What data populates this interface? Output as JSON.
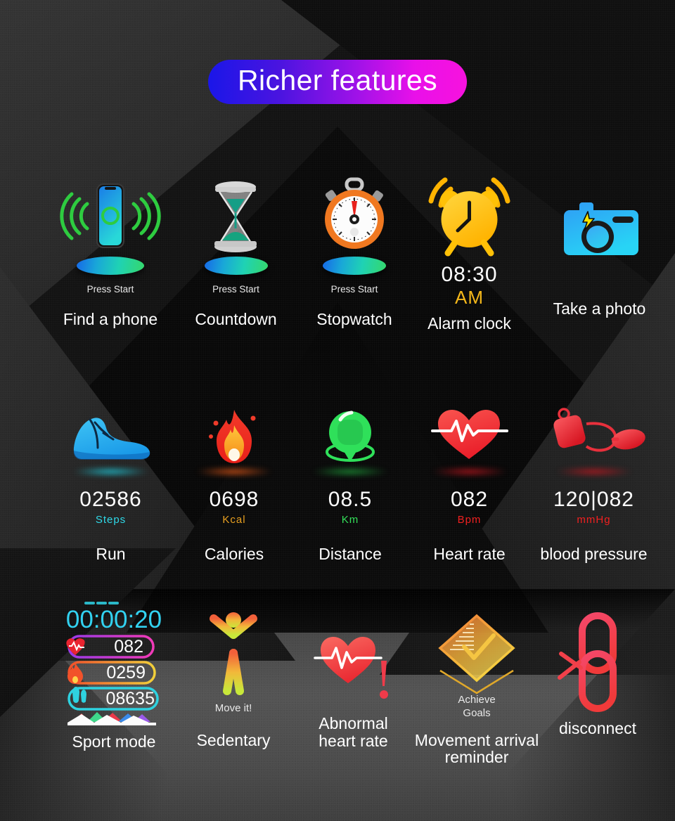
{
  "header": {
    "title": "Richer features"
  },
  "rows": [
    {
      "id": "row-utilities",
      "items": [
        {
          "key": "find-a-phone",
          "icon": "phone-ringing-icon",
          "sub": "Press Start",
          "caption": "Find a phone"
        },
        {
          "key": "countdown",
          "icon": "hourglass-icon",
          "sub": "Press Start",
          "caption": "Countdown"
        },
        {
          "key": "stopwatch",
          "icon": "stopwatch-icon",
          "sub": "Press Start",
          "caption": "Stopwatch"
        },
        {
          "key": "alarm-clock",
          "icon": "alarm-clock-icon",
          "value": "08:30",
          "unit": "AM",
          "caption": "Alarm clock"
        },
        {
          "key": "take-a-photo",
          "icon": "camera-icon",
          "caption": "Take a photo"
        }
      ]
    },
    {
      "id": "row-metrics",
      "items": [
        {
          "key": "run",
          "icon": "running-shoe-icon",
          "value": "02586",
          "unit": "Steps",
          "caption": "Run"
        },
        {
          "key": "calories",
          "icon": "flame-icon",
          "value": "0698",
          "unit": "Kcal",
          "caption": "Calories"
        },
        {
          "key": "distance",
          "icon": "location-pin-icon",
          "value": "08.5",
          "unit": "Km",
          "caption": "Distance"
        },
        {
          "key": "heart-rate",
          "icon": "heart-pulse-icon",
          "value": "082",
          "unit": "Bpm",
          "caption": "Heart rate"
        },
        {
          "key": "blood-pressure",
          "icon": "blood-pressure-icon",
          "value": "120|082",
          "unit": "mmHg",
          "caption": "blood pressure"
        }
      ]
    },
    {
      "id": "row-modes",
      "items": [
        {
          "key": "sport-mode",
          "icon": "sport-mode-watchface-icon",
          "caption": "Sport mode"
        },
        {
          "key": "sedentary",
          "icon": "stretching-person-icon",
          "sub": "Move it!",
          "caption": "Sedentary"
        },
        {
          "key": "abnormal-heart",
          "icon": "heart-alert-icon",
          "caption": "Abnormal\nheart rate"
        },
        {
          "key": "movement-arrival",
          "icon": "achievement-badge-icon",
          "sub": "Achieve\nGoals",
          "caption": "Movement arrival\nreminder"
        },
        {
          "key": "disconnect",
          "icon": "broken-link-icon",
          "caption": "disconnect"
        }
      ]
    }
  ],
  "sport_mode_widget": {
    "dashes": "- - -",
    "timer": "00:00:20",
    "stats": [
      {
        "icon": "heart-icon",
        "value": "082"
      },
      {
        "icon": "flame-icon",
        "value": "0259"
      },
      {
        "icon": "footsteps-icon",
        "value": "08635"
      }
    ]
  },
  "colors": {
    "title_gradient_start": "#1a16e8",
    "title_gradient_end": "#f712de",
    "steps": "#2fd9e8",
    "kcal": "#e8a020",
    "km": "#34e05a",
    "bpm": "#f02020",
    "mmhg": "#f02020",
    "am": "#f5b81a",
    "timer": "#3ad6f0",
    "caption": "#ffffff"
  }
}
